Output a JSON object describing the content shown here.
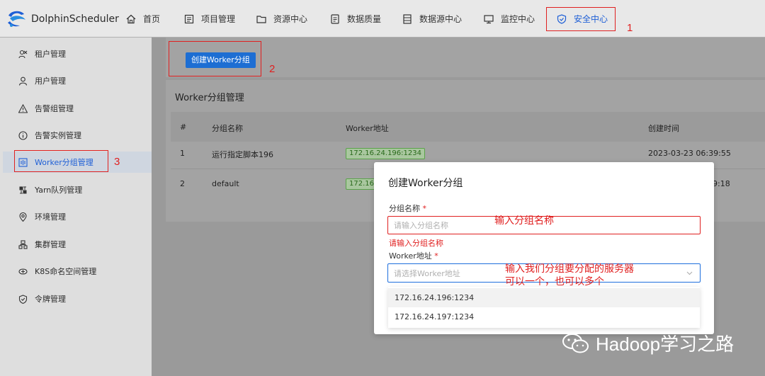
{
  "header": {
    "logo_text": "DolphinScheduler",
    "nav": [
      {
        "label": "首页",
        "icon": "home-icon"
      },
      {
        "label": "项目管理",
        "icon": "project-icon"
      },
      {
        "label": "资源中心",
        "icon": "folder-icon"
      },
      {
        "label": "数据质量",
        "icon": "quality-icon"
      },
      {
        "label": "数据源中心",
        "icon": "datasource-icon"
      },
      {
        "label": "监控中心",
        "icon": "monitor-icon"
      },
      {
        "label": "安全中心",
        "icon": "shield-icon",
        "active": true
      }
    ]
  },
  "sidebar": {
    "items": [
      {
        "label": "租户管理",
        "icon": "tenant-icon"
      },
      {
        "label": "用户管理",
        "icon": "user-icon"
      },
      {
        "label": "告警组管理",
        "icon": "warning-icon"
      },
      {
        "label": "告警实例管理",
        "icon": "info-icon"
      },
      {
        "label": "Worker分组管理",
        "icon": "worker-group-icon",
        "active": true
      },
      {
        "label": "Yarn队列管理",
        "icon": "queue-icon"
      },
      {
        "label": "环境管理",
        "icon": "environment-icon"
      },
      {
        "label": "集群管理",
        "icon": "cluster-icon"
      },
      {
        "label": "K8S命名空间管理",
        "icon": "namespace-icon"
      },
      {
        "label": "令牌管理",
        "icon": "token-icon"
      }
    ]
  },
  "main": {
    "create_button": "创建Worker分组",
    "table_title": "Worker分组管理",
    "columns": [
      "#",
      "分组名称",
      "Worker地址",
      "创建时间"
    ],
    "rows": [
      {
        "index": "1",
        "name": "运行指定脚本196",
        "address": "172.16.24.196:1234",
        "time": "2023-03-23 06:39:55"
      },
      {
        "index": "2",
        "name": "default",
        "address": "172.16",
        "time": "9:18"
      }
    ]
  },
  "modal": {
    "title": "创建Worker分组",
    "name_label": "分组名称",
    "required_mark": "*",
    "name_placeholder": "请输入分组名称",
    "name_error": "请输入分组名称",
    "address_label": "Worker地址",
    "address_placeholder": "请选择Worker地址",
    "options": [
      "172.16.24.196:1234",
      "172.16.24.197:1234"
    ]
  },
  "annotations": {
    "num1": "1",
    "num2": "2",
    "num3": "3",
    "input_note": "输入分组名称",
    "select_note_line1": "输入我们分组要分配的服务器",
    "select_note_line2": "可以一个，也可以多个"
  },
  "watermark": "Hadoop学习之路",
  "colors": {
    "accent": "#1e5fd6",
    "annotation_red": "#e02020",
    "tag_green": "#5aa24a"
  }
}
